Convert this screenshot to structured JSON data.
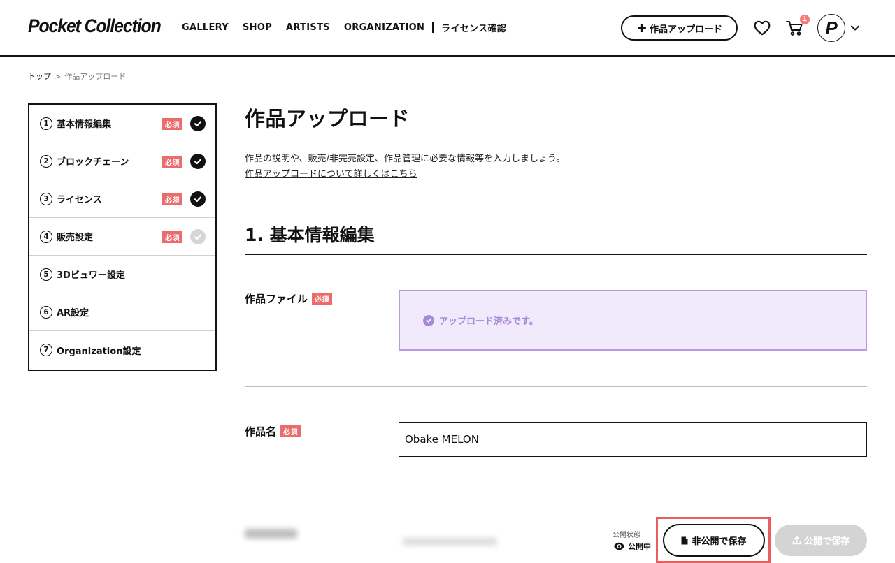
{
  "header": {
    "logo": "Pocket Collection",
    "nav": [
      "GALLERY",
      "SHOP",
      "ARTISTS",
      "ORGANIZATION"
    ],
    "nav_license": "ライセンス確認",
    "upload_label": "作品アップロード",
    "cart_count": "1",
    "avatar_letter": "P"
  },
  "breadcrumb": {
    "home": "トップ",
    "separator": ">",
    "current": "作品アップロード"
  },
  "sidebar": {
    "required_label": "必須",
    "steps": [
      {
        "num": "1",
        "label": "基本情報編集",
        "required": true,
        "status": "done"
      },
      {
        "num": "2",
        "label": "ブロックチェーン",
        "required": true,
        "status": "done"
      },
      {
        "num": "3",
        "label": "ライセンス",
        "required": true,
        "status": "done"
      },
      {
        "num": "4",
        "label": "販売設定",
        "required": true,
        "status": "pending"
      },
      {
        "num": "5",
        "label": "3Dビュワー設定",
        "required": false,
        "status": "none"
      },
      {
        "num": "6",
        "label": "AR設定",
        "required": false,
        "status": "none"
      },
      {
        "num": "7",
        "label": "Organization設定",
        "required": false,
        "status": "none"
      }
    ]
  },
  "main": {
    "title": "作品アップロード",
    "lead": "作品の説明や、販売/非完売設定、作品管理に必要な情報等を入力しましょう。",
    "lead_link": "作品アップロードについて詳しくはこちら",
    "section_title": "1. 基本情報編集",
    "file_field": {
      "label": "作品ファイル",
      "required": "必須",
      "status_text": "アップロード済みです。"
    },
    "name_field": {
      "label": "作品名",
      "required": "必須",
      "value": "Obake MELON"
    }
  },
  "action_bar": {
    "state_label": "公開状態",
    "state_value": "公開中",
    "save_private": "非公開で保存",
    "save_public": "公開で保存"
  },
  "colors": {
    "required_badge": "#ea6c6c",
    "upload_ok": "#a58ad8",
    "highlight": "#ea5d5d",
    "disabled_button": "#d4d4d4"
  }
}
